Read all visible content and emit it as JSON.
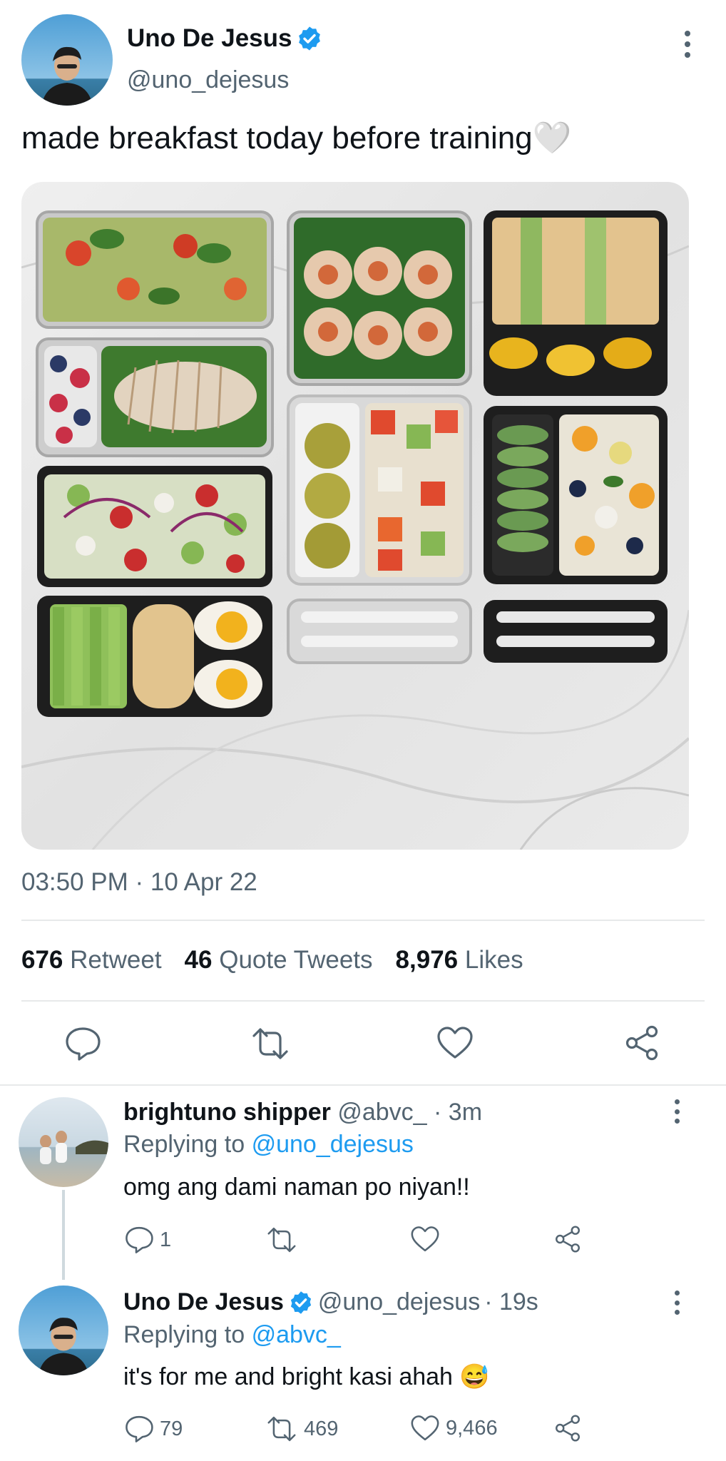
{
  "tweet": {
    "author_name": "Uno De Jesus",
    "author_handle": "@uno_dejesus",
    "text": "made breakfast today before training",
    "emoji": "🤍",
    "timestamp": "03:50 PM · 10 Apr 22",
    "stats": {
      "retweets_count": "676",
      "retweets_label": "Retweet",
      "quotes_count": "46",
      "quotes_label": "Quote Tweets",
      "likes_count": "8,976",
      "likes_label": "Likes"
    },
    "image_icon": "meal-prep-photo"
  },
  "replies": [
    {
      "author_name": "brightuno shipper",
      "author_handle": "@abvc_",
      "time": "· 3m",
      "replying_prefix": "Replying to",
      "replying_to": "@uno_dejesus",
      "text": "omg ang dami naman po niyan!!",
      "reply_count": "1",
      "retweet_count": "",
      "like_count": ""
    },
    {
      "author_name": "Uno De Jesus",
      "author_handle": "@uno_dejesus",
      "time": "· 19s",
      "replying_prefix": "Replying to",
      "replying_to": "@abvc_",
      "text": "it's for me and bright kasi ahah 😅",
      "reply_count": "79",
      "retweet_count": "469",
      "like_count": "9,466"
    }
  ],
  "colors": {
    "accent": "#1d9bf0",
    "text": "#0f1419",
    "muted": "#536471",
    "divider": "#e7e9ea"
  }
}
